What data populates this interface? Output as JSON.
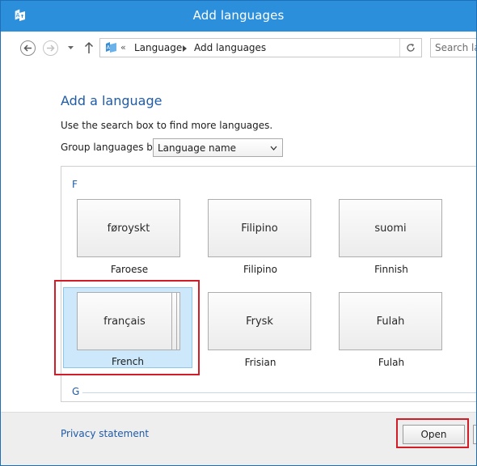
{
  "window": {
    "title": "Add languages",
    "titlebar_color": "#2b8fdb"
  },
  "address_bar": {
    "overflow_chevron": "«",
    "breadcrumbs": [
      "Language",
      "Add languages"
    ],
    "search_placeholder": "Search lan"
  },
  "main": {
    "title": "Add a language",
    "hint": "Use the search box to find more languages.",
    "group_by_label": "Group languages by:",
    "group_by_value": "Language name"
  },
  "groups": [
    {
      "letter": "F",
      "languages": [
        {
          "native": "føroyskt",
          "english": "Faroese"
        },
        {
          "native": "Filipino",
          "english": "Filipino"
        },
        {
          "native": "suomi",
          "english": "Finnish"
        },
        {
          "native": "français",
          "english": "French",
          "selected": true
        },
        {
          "native": "Frysk",
          "english": "Frisian"
        },
        {
          "native": "Fulah",
          "english": "Fulah"
        }
      ]
    },
    {
      "letter": "G",
      "languages": []
    }
  ],
  "footer": {
    "privacy_link": "Privacy statement",
    "open_button": "Open"
  },
  "colors": {
    "accent_text": "#1e5ba8",
    "selection_bg": "#cce8fa",
    "highlight_red": "#d21c28"
  }
}
